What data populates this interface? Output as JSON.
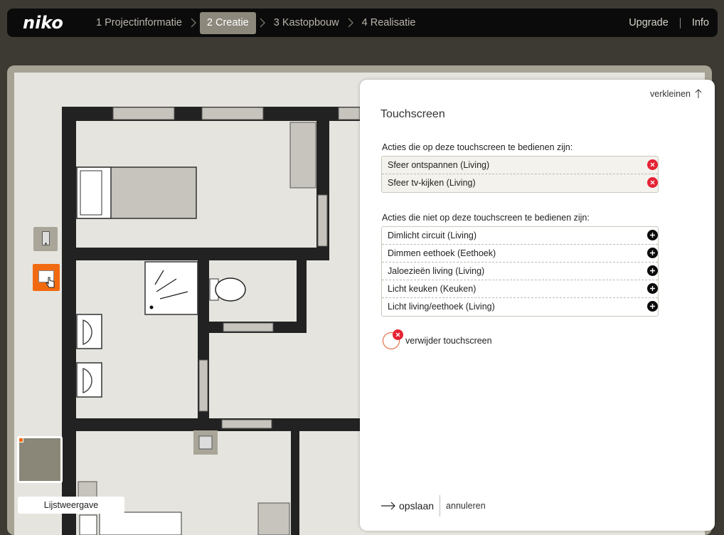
{
  "app": {
    "logo": "niko"
  },
  "steps": [
    {
      "label": "1 Projectinformatie",
      "active": false
    },
    {
      "label": "2 Creatie",
      "active": true
    },
    {
      "label": "3 Kastopbouw",
      "active": false
    },
    {
      "label": "4 Realisatie",
      "active": false
    }
  ],
  "topnav": {
    "upgrade": "Upgrade",
    "info": "Info"
  },
  "sidebar": {
    "list_view": "Lijstweergave"
  },
  "panel": {
    "collapse": "verkleinen",
    "title": "Touchscreen",
    "active_label": "Acties die op deze touchscreen te bedienen zijn:",
    "active_actions": [
      "Sfeer ontspannen (Living)",
      "Sfeer tv-kijken (Living)"
    ],
    "inactive_label": "Acties die niet op deze touchscreen te bedienen zijn:",
    "inactive_actions": [
      "Dimlicht circuit (Living)",
      "Dimmen eethoek (Eethoek)",
      "Jaloezieën living (Living)",
      "Licht keuken (Keuken)",
      "Licht living/eethoek (Living)"
    ],
    "delete": "verwijder touchscreen",
    "save": "opslaan",
    "cancel": "annuleren"
  },
  "colors": {
    "accent": "#f26a10",
    "remove": "#e52234",
    "topbar": "#0b0b0b",
    "frame": "#a7a394"
  }
}
